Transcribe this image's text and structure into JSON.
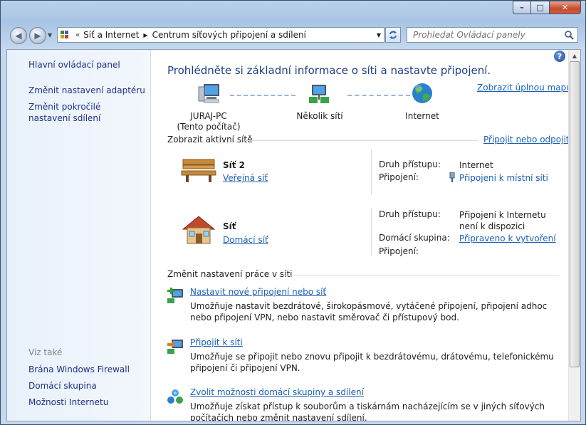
{
  "window": {
    "minimize": "–",
    "maximize": "□",
    "close": "✕"
  },
  "nav": {
    "back_icon": "back-arrow-icon",
    "forward_icon": "forward-arrow-icon"
  },
  "address": {
    "prefix": "«",
    "segments": [
      "Síť a Internet",
      "Centrum síťových připojení a sdílení"
    ],
    "separator": "▶"
  },
  "search": {
    "placeholder": "Prohledat Ovládací panely"
  },
  "sidebar": {
    "home": "Hlavní ovládací panel",
    "adapter": "Změnit nastavení adaptéru",
    "advanced": "Změnit pokročilé nastavení sdílení",
    "see_also": "Viz také",
    "firewall": "Brána Windows Firewall",
    "homegroup": "Domácí skupina",
    "internet_options": "Možnosti Internetu"
  },
  "main": {
    "title": "Prohlédněte si základní informace o síti a nastavte připojení.",
    "full_map": "Zobrazit úplnou mapu",
    "map": {
      "pc_name": "JURAJ-PC",
      "pc_sub": "(Tento počítač)",
      "multi": "Několik sítí",
      "internet": "Internet"
    },
    "active_header": "Zobrazit aktivní sítě",
    "connect_link": "Připojit nebo odpojit",
    "networks": [
      {
        "name": "Síť  2",
        "type": "Veřejná síť",
        "access_label": "Druh přístupu:",
        "access_value": "Internet",
        "conn_label": "Připojení:",
        "conn_value": "Připojení k místní síti"
      },
      {
        "name": "Síť",
        "type": "Domácí síť",
        "access_label": "Druh přístupu:",
        "access_value": "Připojení k Internetu není k dispozici",
        "hg_label": "Domácí skupina:",
        "hg_value": "Připraveno k vytvoření",
        "conn_label": "Připojení:"
      }
    ],
    "change_header": "Změnit nastavení práce v síti",
    "tasks": [
      {
        "link": "Nastavit nové připojení nebo síť",
        "desc": "Umožňuje nastavit bezdrátové, širokopásmové, vytáčené připojení, připojení adhoc nebo připojení VPN, nebo nastavit směrovač či přístupový bod."
      },
      {
        "link": "Připojit k síti",
        "desc": "Umožňuje se připojit nebo znovu připojit k bezdrátovému, drátovému, telefonickému připojení či připojení VPN."
      },
      {
        "link": "Zvolit možnosti domácí skupiny a sdílení",
        "desc": "Umožňuje získat přístup k souborům a tiskárnám nacházejícím se v jiných síťových počítačích nebo změnit nastavení sdílení."
      }
    ]
  },
  "help": "?"
}
